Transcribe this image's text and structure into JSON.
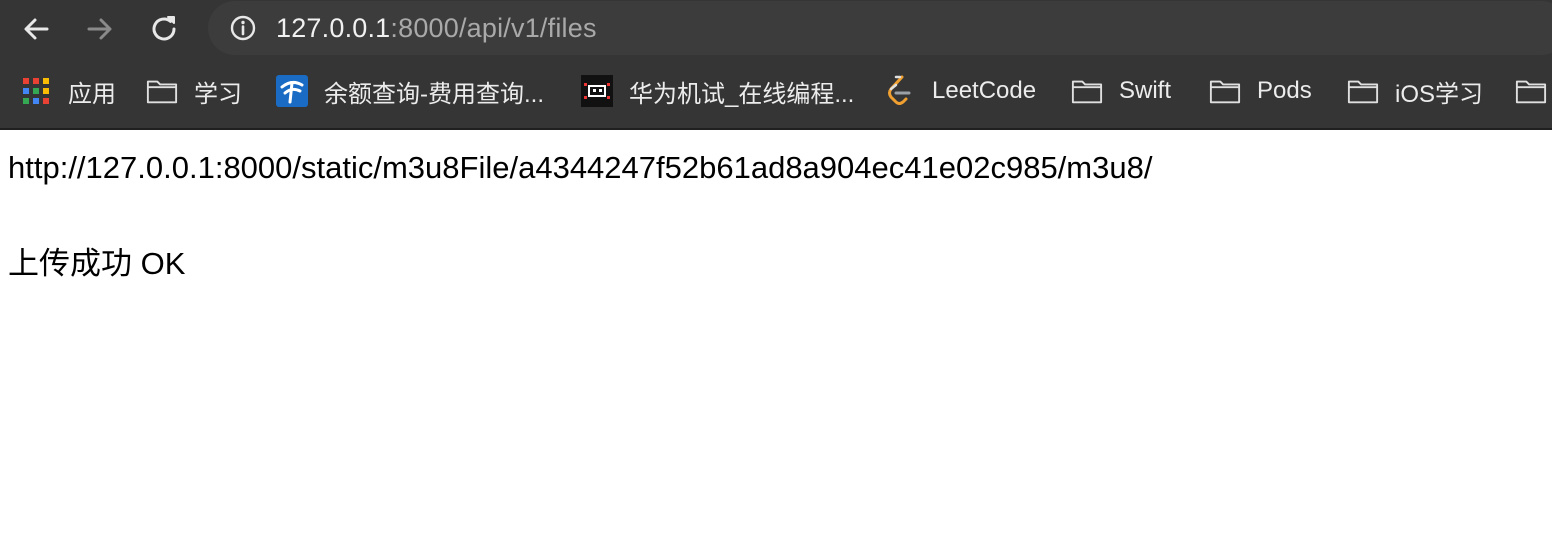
{
  "browser": {
    "url_host": "127.0.0.1",
    "url_rest": ":8000/api/v1/files",
    "bookmarks": [
      {
        "label": "应用",
        "icon": "apps-grid-icon"
      },
      {
        "label": "学习",
        "icon": "folder-icon"
      },
      {
        "label": "余额查询-费用查询...",
        "icon": "china-telecom-icon"
      },
      {
        "label": "华为机试_在线编程...",
        "icon": "nowcoder-icon"
      },
      {
        "label": "LeetCode",
        "icon": "leetcode-icon"
      },
      {
        "label": "Swift",
        "icon": "folder-icon"
      },
      {
        "label": "Pods",
        "icon": "folder-icon"
      },
      {
        "label": "iOS学习",
        "icon": "folder-icon"
      }
    ],
    "colors": {
      "toolbar": "#353535",
      "omnibox": "#3c3c3c"
    }
  },
  "page": {
    "url_line": "http://127.0.0.1:8000/static/m3u8File/a4344247f52b61ad8a904ec41e02c985/m3u8/",
    "status_line": "上传成功 OK"
  }
}
